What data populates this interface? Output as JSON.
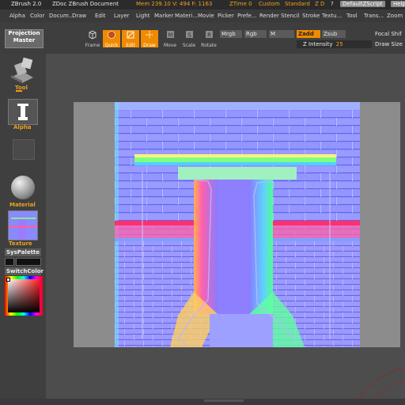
{
  "titlebar": {
    "app": "ZBrush 2.0",
    "doc": "ZDoc ZBrush Document",
    "mem": "Mem 239.10 V: 494 F: 1163",
    "ztime": "ZTime 0",
    "custom": "Custom",
    "standard": "Standard",
    "z_d": "Z D",
    "help_q": "?",
    "script": "DefaultZScript",
    "help": "Help"
  },
  "menu": [
    "Alpha",
    "Color",
    "Docum...",
    "Draw",
    "Edit",
    "Layer",
    "Light",
    "Marker",
    "Materi...",
    "Movie",
    "Picker",
    "Prefe...",
    "Render",
    "Stencil",
    "Stroke",
    "Textu...",
    "Tool",
    "Trans...",
    "Zoom"
  ],
  "shelf": {
    "projection_master": "Projection Master",
    "buttons": [
      {
        "label": "Frame",
        "icon": "cube-icon",
        "on": false
      },
      {
        "label": "Quick",
        "icon": "sphere-icon",
        "on": true
      },
      {
        "label": "Edit",
        "icon": "edit-icon",
        "on": true
      },
      {
        "label": "Draw",
        "icon": "draw-icon",
        "on": true
      },
      {
        "label": "Move",
        "icon": "move-icon",
        "on": false
      },
      {
        "label": "Scale",
        "icon": "scale-icon",
        "on": false
      },
      {
        "label": "Rotate",
        "icon": "rotate-icon",
        "on": false
      }
    ],
    "mrgb": "Mrgb",
    "rgb": "Rgb",
    "m": "M",
    "zadd": "Zadd",
    "zsub": "Zsub",
    "zintensity_label": "Z Intensity",
    "zintensity_value": "25",
    "focal_shift": "Focal Shif",
    "draw_size": "Draw Size"
  },
  "left": {
    "tool": "Tool",
    "alpha": "Alpha",
    "material": "Material",
    "texture": "Texture",
    "syspalette": "SysPalette",
    "switchcolor": "SwitchColor"
  },
  "colors": {
    "accent": "#f08a00",
    "label_orange": "#f0a020"
  }
}
